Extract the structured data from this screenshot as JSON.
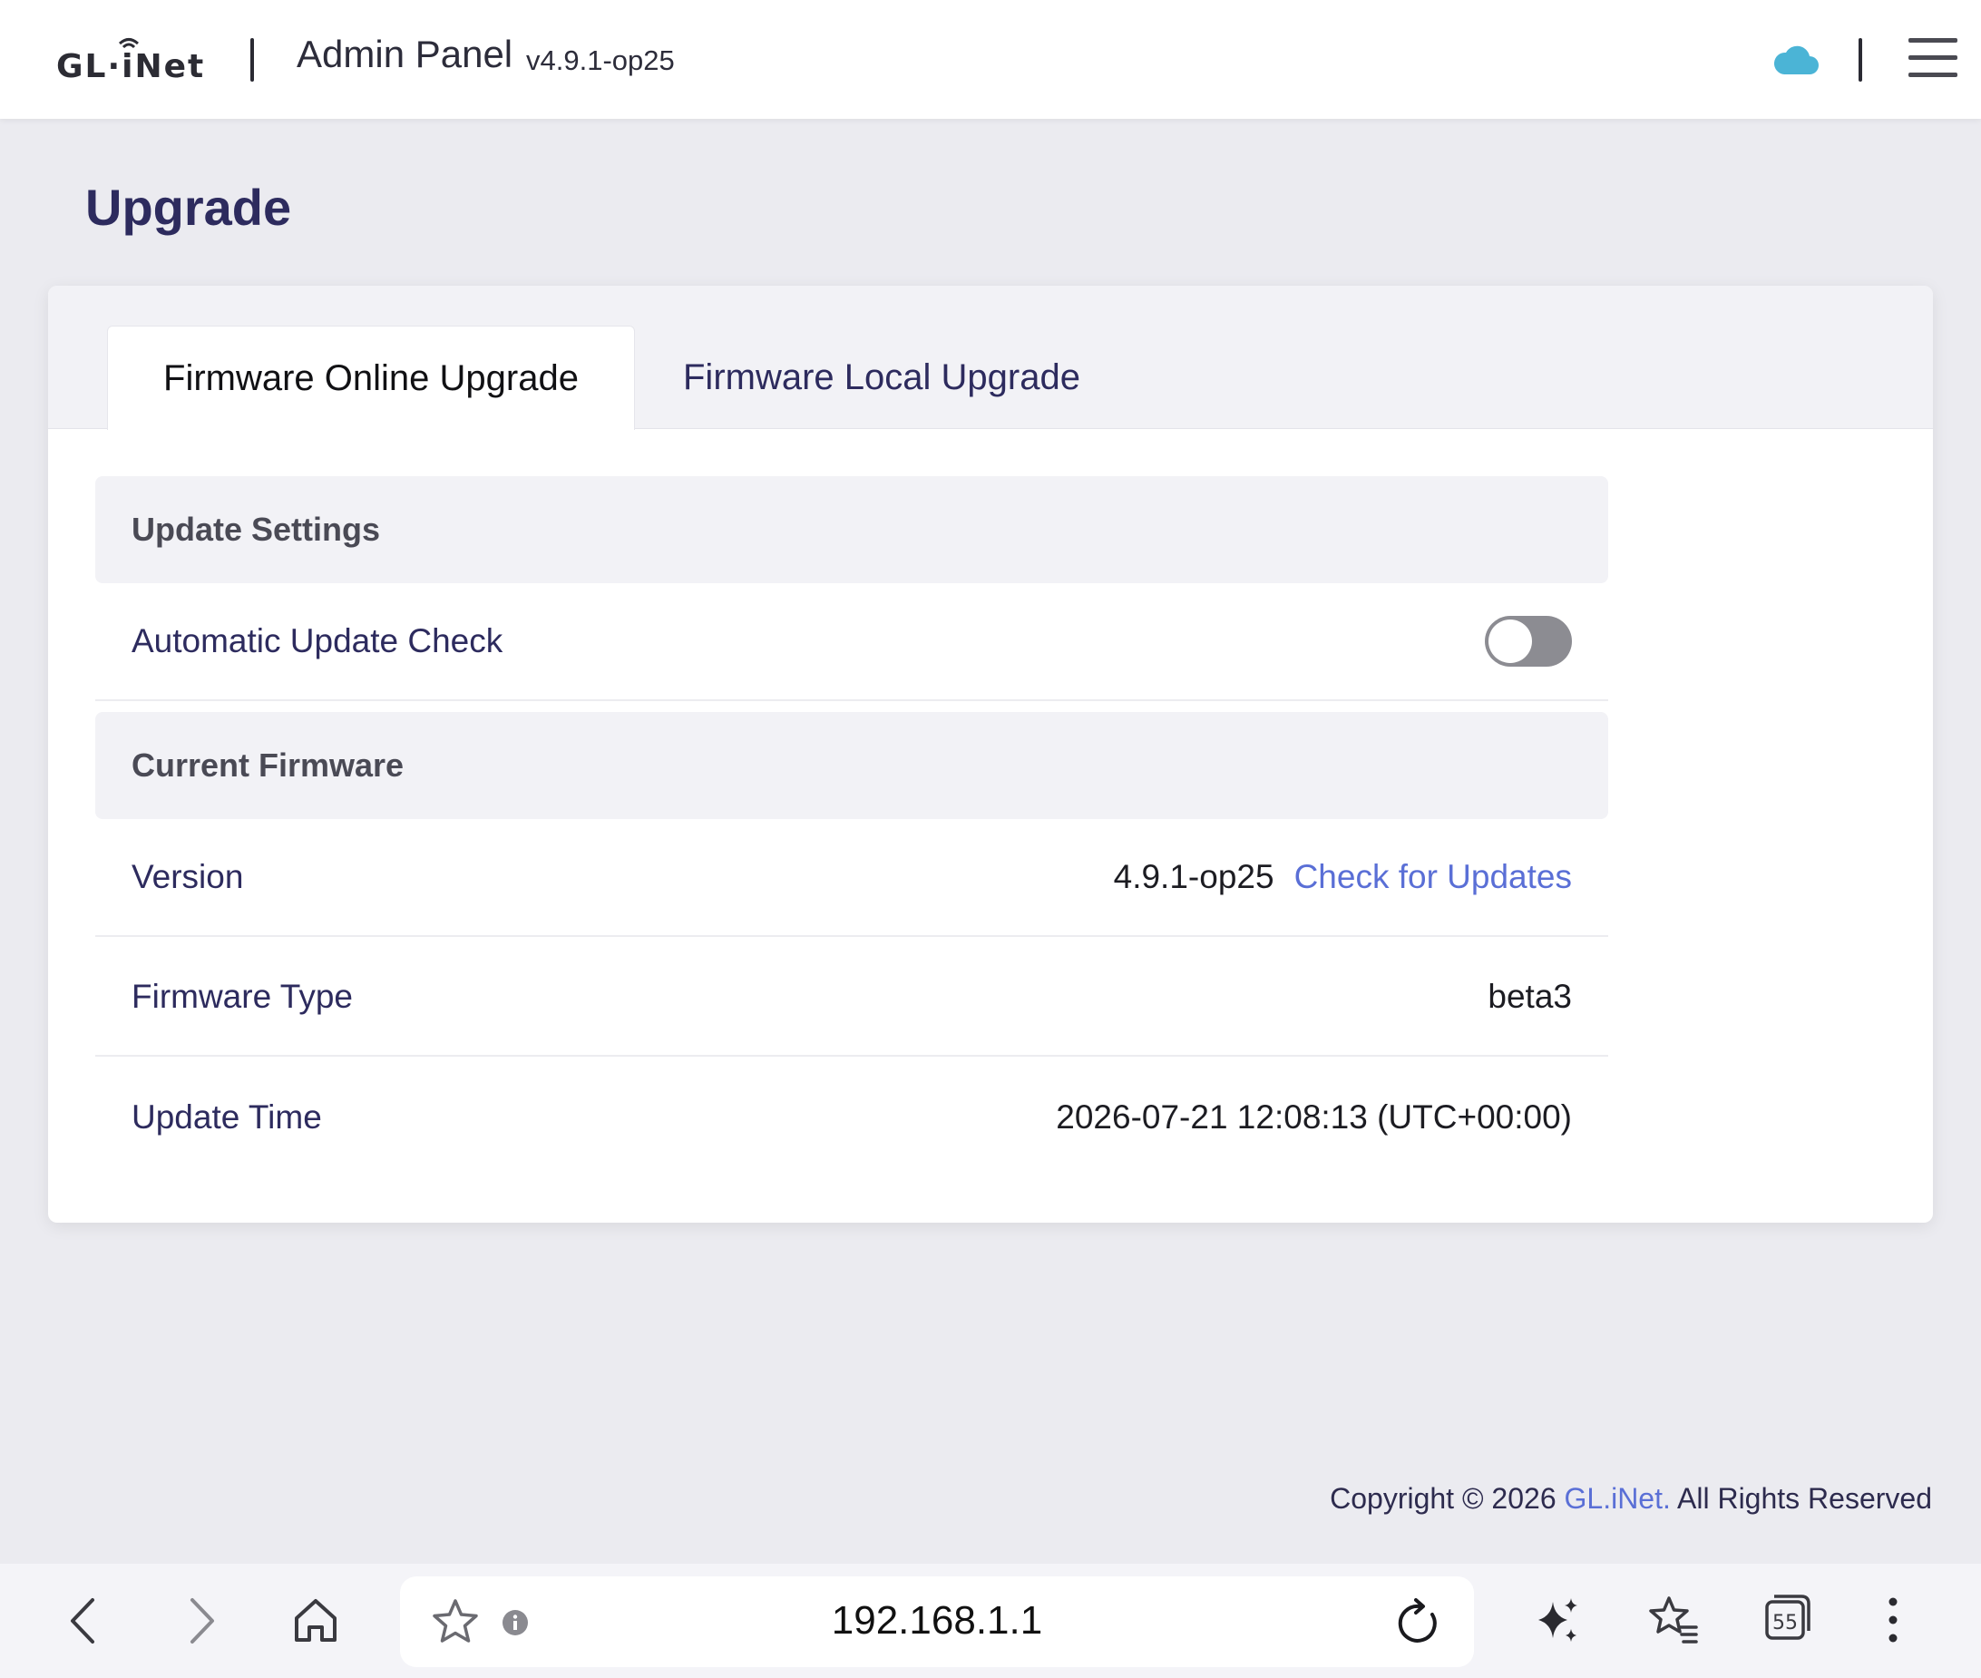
{
  "header": {
    "logo_text": "GL·iNet",
    "title": "Admin Panel",
    "version": "v4.9.1-op25",
    "cloud_icon": "cloud-icon",
    "menu_icon": "hamburger-menu-icon",
    "cloud_color": "#4bb4d6"
  },
  "page": {
    "title": "Upgrade"
  },
  "tabs": [
    {
      "label": "Firmware Online Upgrade",
      "active": true
    },
    {
      "label": "Firmware Local Upgrade",
      "active": false
    }
  ],
  "update_settings": {
    "heading": "Update Settings",
    "auto_check_label": "Automatic Update Check",
    "auto_check_enabled": false
  },
  "current_firmware": {
    "heading": "Current Firmware",
    "version_label": "Version",
    "version_value": "4.9.1-op25",
    "check_updates_label": "Check for Updates",
    "type_label": "Firmware Type",
    "type_value": "beta3",
    "time_label": "Update Time",
    "time_value": "2026-07-21 12:08:13 (UTC+00:00)"
  },
  "footer": {
    "prefix": "Copyright © 2026 ",
    "brand": "GL.iNet.",
    "suffix": " All Rights Reserved"
  },
  "browser": {
    "url": "192.168.1.1",
    "tab_count": "55",
    "icons": [
      "back-icon",
      "forward-icon",
      "home-icon",
      "bookmark-star-icon",
      "info-icon",
      "reload-icon",
      "ai-sparkle-icon",
      "bookmarks-list-icon",
      "tabs-icon",
      "more-icon"
    ]
  },
  "colors": {
    "accent": "#5a6fd6",
    "title": "#2d2b5e",
    "background": "#ebebf0"
  }
}
